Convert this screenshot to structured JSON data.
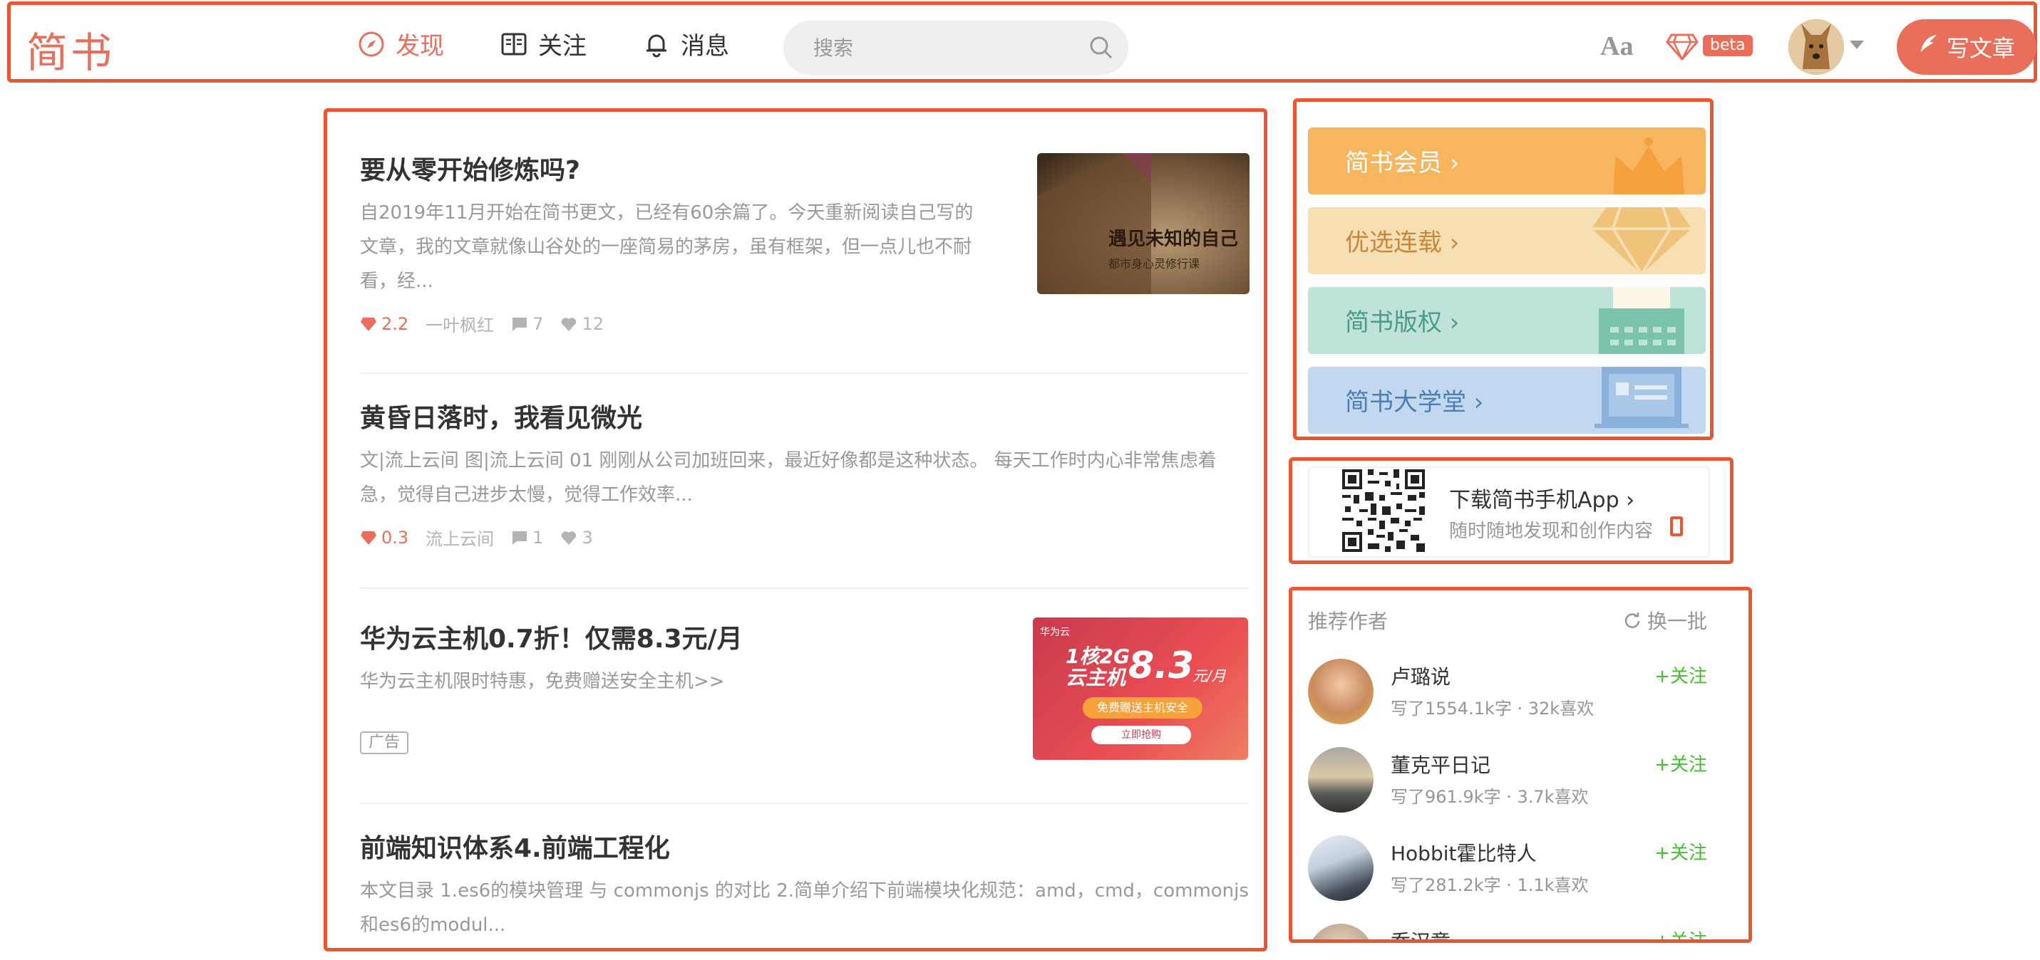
{
  "header": {
    "logo": "简书",
    "nav": [
      {
        "label": "发现",
        "icon": "compass-icon",
        "active": true
      },
      {
        "label": "关注",
        "icon": "book-icon",
        "active": false
      },
      {
        "label": "消息",
        "icon": "bell-icon",
        "active": false
      }
    ],
    "search_placeholder": "搜索",
    "font_toggle": "Aa",
    "beta": "beta",
    "write_label": "写文章",
    "accent": "#ea6f5a"
  },
  "articles": [
    {
      "title": "要从零开始修炼吗?",
      "abstract": "自2019年11月开始在简书更文，已经有60余篇了。今天重新阅读自己写的文章，我的文章就像山谷处的一座简易的茅房，虽有框架，但一点儿也不耐看，经...",
      "jsd": "2.2",
      "author": "一叶枫红",
      "comments": "7",
      "likes": "12",
      "thumb_text": "遇见未知的自己",
      "thumb_sub": "都市身心灵修行课"
    },
    {
      "title": "黄昏日落时，我看见微光",
      "abstract": "文|流上云间 图|流上云间 01 刚刚从公司加班回来，最近好像都是这种状态。 每天工作时内心非常焦虑着急，觉得自己进步太慢，觉得工作效率...",
      "jsd": "0.3",
      "author": "流上云间",
      "comments": "1",
      "likes": "3"
    },
    {
      "title": "华为云主机0.7折！仅需8.3元/月",
      "abstract": "华为云主机限时特惠，免费赠送安全主机>>",
      "ad_tag": "广告",
      "ad_brand": "华为云",
      "ad_line1": "1核2G",
      "ad_line2": "云主机",
      "ad_price": "8.3",
      "ad_unit": "元/月",
      "ad_pill": "免费赠送主机安全",
      "ad_btn": "立即抢购"
    },
    {
      "title": "前端知识体系4.前端工程化",
      "abstract": "本文目录 1.es6的模块管理 与 commonjs 的对比 2.简单介绍下前端模块化规范：amd，cmd，commonjs和es6的modul..."
    }
  ],
  "banners": [
    {
      "label": "简书会员",
      "bg": "#f7b55e",
      "color": "#ffffff",
      "icon": "crown-icon"
    },
    {
      "label": "优选连载",
      "bg": "#f5dfb3",
      "color": "#c8873c",
      "icon": "diamond-icon"
    },
    {
      "label": "简书版权",
      "bg": "#bfe3d9",
      "color": "#4d9c87",
      "icon": "typewriter-icon"
    },
    {
      "label": "简书大学堂",
      "bg": "#c2d8ee",
      "color": "#4d7fb4",
      "icon": "screen-icon"
    }
  ],
  "download": {
    "title": "下载简书手机App",
    "subtitle": "随时随地发现和创作内容"
  },
  "authors": {
    "heading": "推荐作者",
    "refresh": "换一批",
    "follow": "+关注",
    "items": [
      {
        "name": "卢璐说",
        "stat": "写了1554.1k字 · 32k喜欢"
      },
      {
        "name": "董克平日记",
        "stat": "写了961.9k字 · 3.7k喜欢"
      },
      {
        "name": "Hobbit霍比特人",
        "stat": "写了281.2k字 · 1.1k喜欢"
      },
      {
        "name": "乔汉童",
        "stat": ""
      }
    ]
  }
}
